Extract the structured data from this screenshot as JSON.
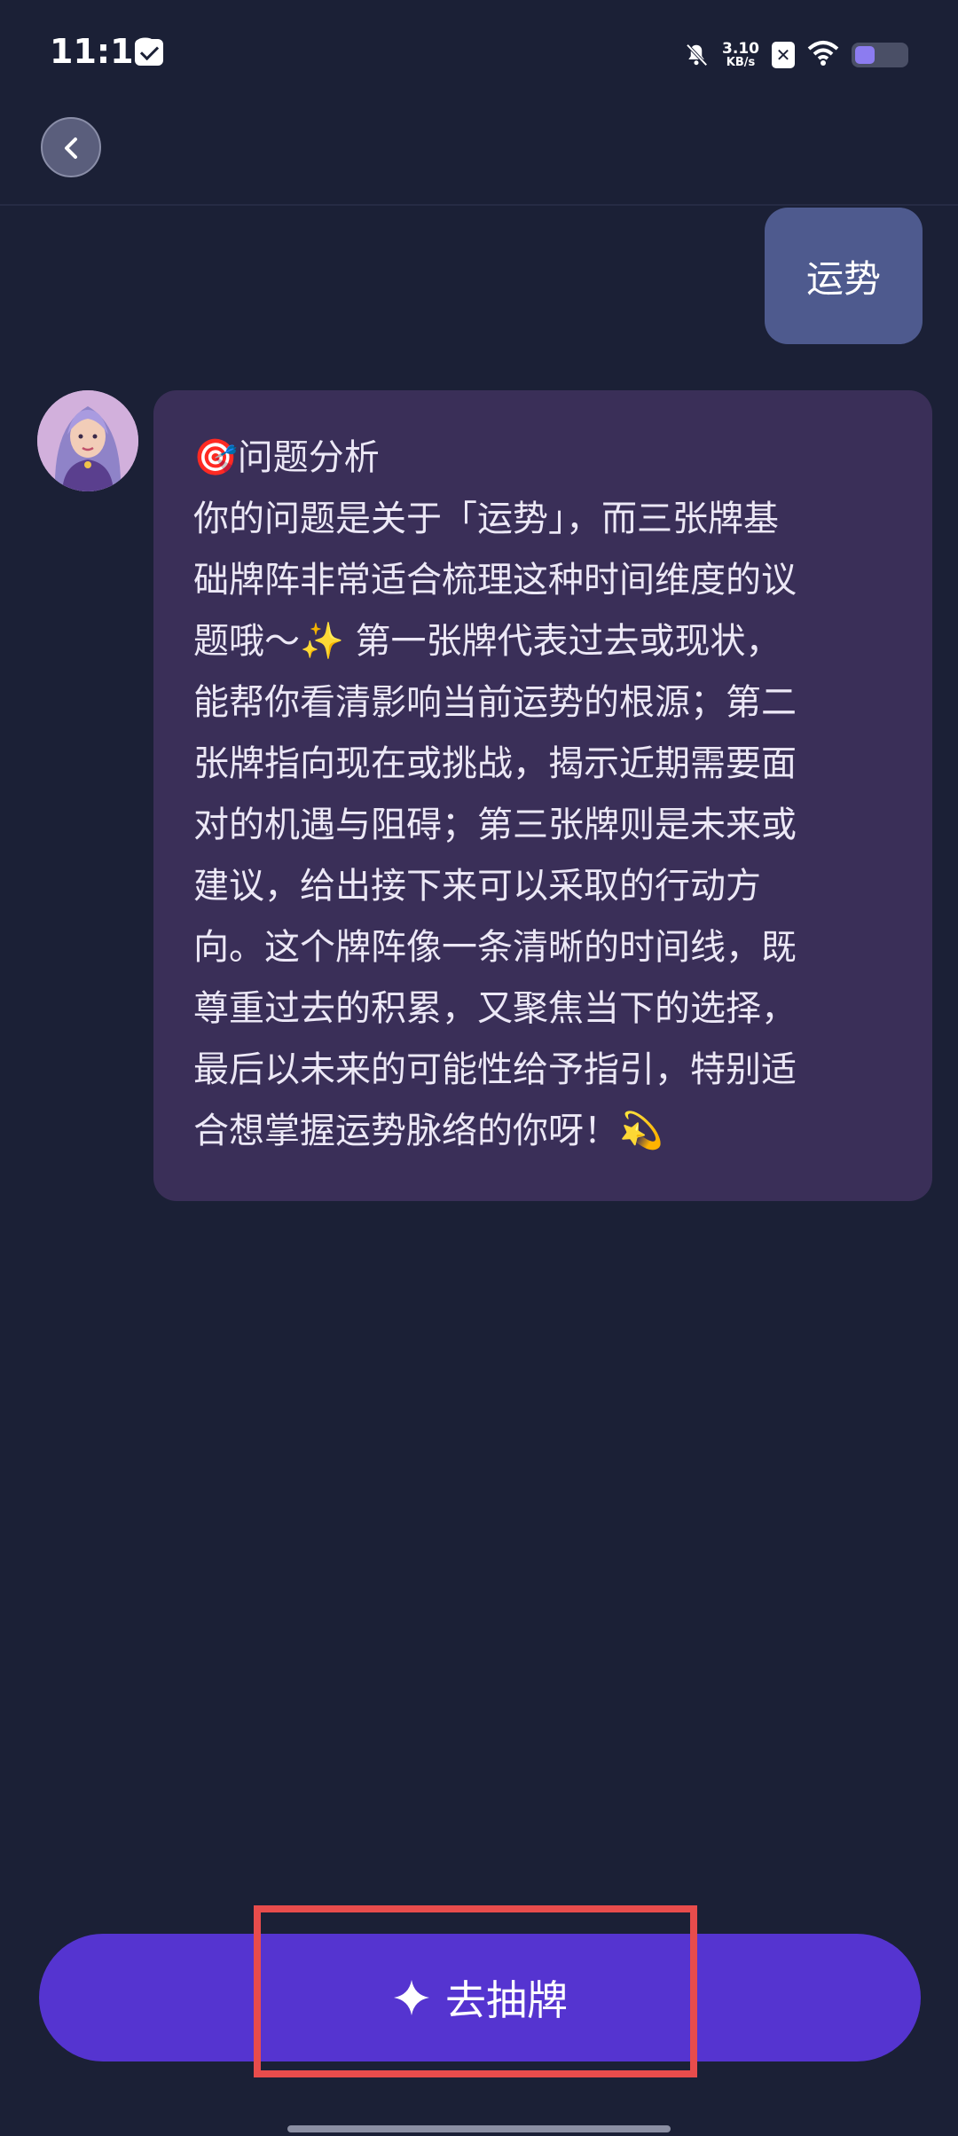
{
  "status_bar": {
    "time": "11:18",
    "net_speed_value": "3.10",
    "net_speed_unit": "KB/s",
    "sim_badge": "✕",
    "battery_level": 0.4,
    "icons": [
      "mail-icon",
      "bell-off-icon",
      "sim-x-icon",
      "wifi-icon",
      "battery-icon"
    ]
  },
  "header": {
    "back_icon": "chevron-left-icon"
  },
  "chat": {
    "user_message": "运势",
    "assistant": {
      "avatar": "tarot-reader-avatar",
      "lines": [
        "🎯问题分析",
        "你的问题是关于「运势」，而三张牌基",
        "础牌阵非常适合梳理这种时间维度的议",
        "题哦～✨ 第一张牌代表过去或现状，",
        "能帮你看清影响当前运势的根源；第二",
        "张牌指向现在或挑战，揭示近期需要面",
        "对的机遇与阻碍；第三张牌则是未来或",
        "建议，给出接下来可以采取的行动方",
        "向。这个牌阵像一条清晰的时间线，既",
        "尊重过去的积累，又聚焦当下的选择，",
        "最后以未来的可能性给予指引，特别适",
        "合想掌握运势脉络的你呀！💫"
      ]
    }
  },
  "action": {
    "draw_card_label": "去抽牌",
    "icon": "sparkle-icon"
  },
  "colors": {
    "background": "#1b2036",
    "user_bubble": "#4e5a8e",
    "assistant_bubble": "#3a2f58",
    "button": "#5534d0",
    "highlight": "#e84c4c"
  }
}
